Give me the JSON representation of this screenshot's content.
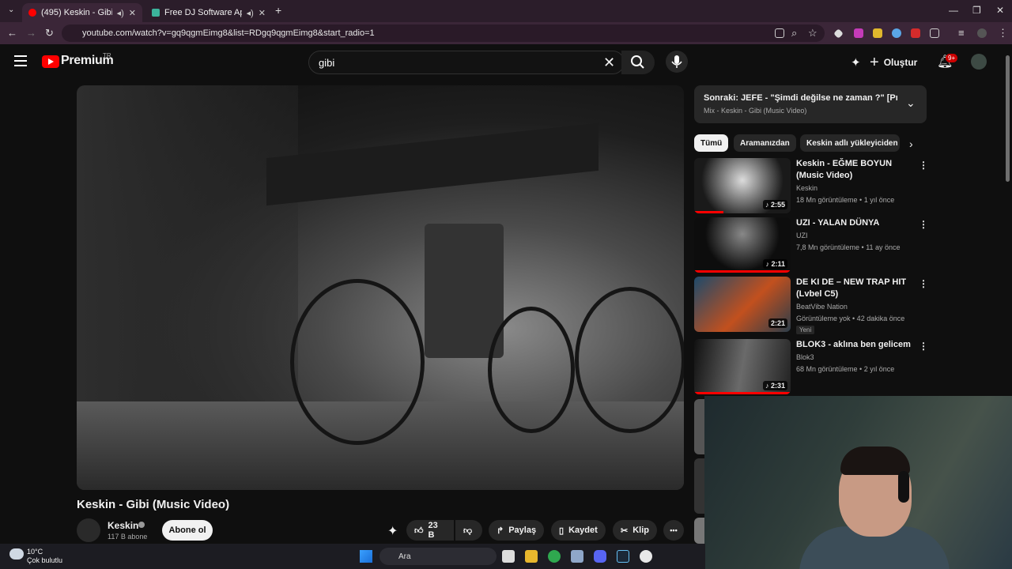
{
  "browser": {
    "tabs": [
      {
        "title": "(495) Keskin - Gibi (Music V",
        "active": true
      },
      {
        "title": "Free DJ Software App for O",
        "active": false
      }
    ],
    "new_tab": "+",
    "url": "youtube.com/watch?v=gq9qgmEimg8&list=RDgq9qgmEimg8&start_radio=1"
  },
  "masthead": {
    "brand": "Premium",
    "region": "TR",
    "search_query": "gibi",
    "create_label": "Oluştur",
    "notification_count": "9+"
  },
  "video": {
    "title": "Keskin - Gibi (Music Video)",
    "channel": "Keskin",
    "subscribers": "117 B abone",
    "subscribe_label": "Abone ol",
    "likes": "23 B",
    "share_label": "Paylaş",
    "save_label": "Kaydet",
    "clip_label": "Klip",
    "more_label": "•••"
  },
  "up_next": {
    "title": "Sonraki: JEFE - \"Şimdi değilse ne zaman ?\" [Prod. b...",
    "subtitle": "Mix - Keskin - Gibi (Music Video)"
  },
  "chips": [
    "Tümü",
    "Aramanızdan",
    "Keskin adlı yükleyiciden"
  ],
  "recommendations": [
    {
      "title": "Keskin - EĞME BOYUN (Music Video)",
      "channel": "Keskin",
      "meta": "18 Mn görüntüleme • 1 yıl önce",
      "duration": "♪ 2:55",
      "progress": 0.3,
      "thumb_color": "#1a1a1a"
    },
    {
      "title": "UZI - YALAN DÜNYA",
      "channel": "UZI",
      "meta": "7,8 Mn görüntüleme • 11 ay önce",
      "duration": "♪ 2:11",
      "progress": 1.0,
      "thumb_color": "#0d0d0d"
    },
    {
      "title": "DE KI DE – NEW TRAP HIT (Lvbel C5)",
      "channel": "BeatVibe Nation",
      "meta": "Görüntüleme yok • 42 dakika önce",
      "badge": "Yeni",
      "duration": "2:21",
      "progress": 0,
      "thumb_color": "#2a4a5a"
    },
    {
      "title": "BLOK3 - aklına ben gelicem",
      "channel": "Blok3",
      "meta": "68 Mn görüntüleme • 2 yıl önce",
      "duration": "♪ 2:31",
      "progress": 1.0,
      "thumb_color": "#3a3a3a"
    }
  ],
  "taskbar": {
    "weather_temp": "10°C",
    "weather_desc": "Çok bulutlu",
    "search_placeholder": "Ara"
  },
  "colors": {
    "accent_red": "#ff0000",
    "chrome_bg": "#2b1d2a",
    "page_bg": "#0f0f0f"
  }
}
